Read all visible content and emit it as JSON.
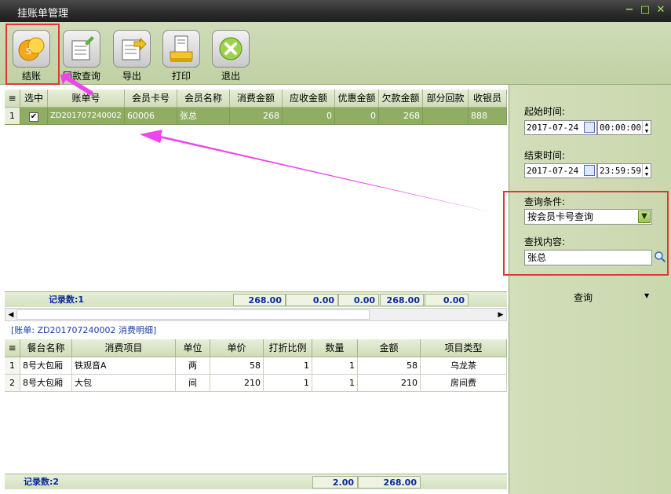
{
  "window": {
    "title": "挂账单管理",
    "minimize": "−",
    "maximize": "□",
    "close": "✕"
  },
  "toolbar": {
    "buttons": [
      {
        "label": "结账",
        "icon": "coins-icon"
      },
      {
        "label": "回款查询",
        "icon": "document-edit-icon"
      },
      {
        "label": "导出",
        "icon": "export-icon"
      },
      {
        "label": "打印",
        "icon": "printer-icon"
      },
      {
        "label": "退出",
        "icon": "exit-icon"
      }
    ]
  },
  "bill_table": {
    "columns": [
      "选中",
      "账单号",
      "会员卡号",
      "会员名称",
      "消费金额",
      "应收金额",
      "优惠金额",
      "欠款金额",
      "部分回款",
      "收银员"
    ],
    "rows": [
      {
        "index": "1",
        "checked": "✔",
        "bill_no": "ZD201707240002",
        "card_no": "60006",
        "member": "张总",
        "consume": "268",
        "receivable": "0",
        "discount": "0",
        "debt": "268",
        "partial": "",
        "cashier": "888"
      }
    ],
    "footer": {
      "record_count": "记录数:1",
      "consume_sum": "268.00",
      "receivable_sum": "0.00",
      "discount_sum": "0.00",
      "debt_sum": "268.00",
      "partial_sum": "0.00"
    }
  },
  "detail": {
    "title": "[账单: ZD201707240002 消费明细]",
    "columns": [
      "餐台名称",
      "消费项目",
      "单位",
      "单价",
      "打折比例",
      "数量",
      "金额",
      "项目类型"
    ],
    "rows": [
      {
        "index": "1",
        "table": "8号大包厢",
        "item": "铁观音A",
        "unit": "两",
        "price": "58",
        "discount": "1",
        "qty": "1",
        "amount": "58",
        "type": "乌龙茶"
      },
      {
        "index": "2",
        "table": "8号大包厢",
        "item": "大包",
        "unit": "间",
        "price": "210",
        "discount": "1",
        "qty": "1",
        "amount": "210",
        "type": "房间费"
      }
    ],
    "footer": {
      "record_count": "记录数:2",
      "qty_sum": "2.00",
      "amount_sum": "268.00"
    }
  },
  "filter": {
    "start_label": "起始时间:",
    "start_date": "2017-07-24",
    "start_time": "00:00:00",
    "end_label": "结束时间:",
    "end_date": "2017-07-24",
    "end_time": "23:59:59",
    "condition_label": "查询条件:",
    "condition_value": "按会员卡号查询",
    "content_label": "查找内容:",
    "content_value": "张总",
    "query_button": "查询"
  },
  "colors": {
    "accent_green": "#8fae63",
    "panel": "#cad8ae",
    "highlight": "#e53535",
    "arrow": "#ee44ee"
  }
}
